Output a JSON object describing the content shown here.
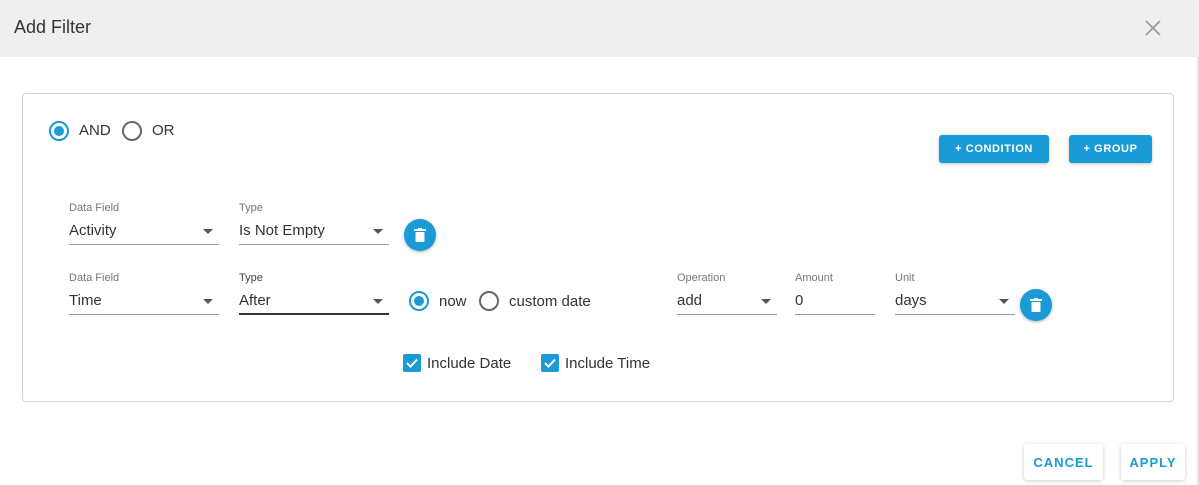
{
  "dialog": {
    "title": "Add Filter"
  },
  "logic": {
    "and_label": "AND",
    "or_label": "OR",
    "selected": "AND"
  },
  "buttons": {
    "add_condition": "+ CONDITION",
    "add_group": "+ GROUP",
    "cancel": "CANCEL",
    "apply": "APPLY"
  },
  "conditions": [
    {
      "data_field_label": "Data Field",
      "data_field_value": "Activity",
      "type_label": "Type",
      "type_value": "Is Not Empty"
    },
    {
      "data_field_label": "Data Field",
      "data_field_value": "Time",
      "type_label": "Type",
      "type_value": "After",
      "reference": {
        "now_label": "now",
        "custom_label": "custom date",
        "selected": "now"
      },
      "operation_label": "Operation",
      "operation_value": "add",
      "amount_label": "Amount",
      "amount_value": "0",
      "unit_label": "Unit",
      "unit_value": "days",
      "include_date_label": "Include Date",
      "include_date_checked": true,
      "include_time_label": "Include Time",
      "include_time_checked": true
    }
  ],
  "colors": {
    "accent": "#1a9ad6",
    "header_bg": "#efefef"
  },
  "icons": {
    "close": "close-icon",
    "delete": "trash-icon",
    "check": "checkmark-icon"
  }
}
